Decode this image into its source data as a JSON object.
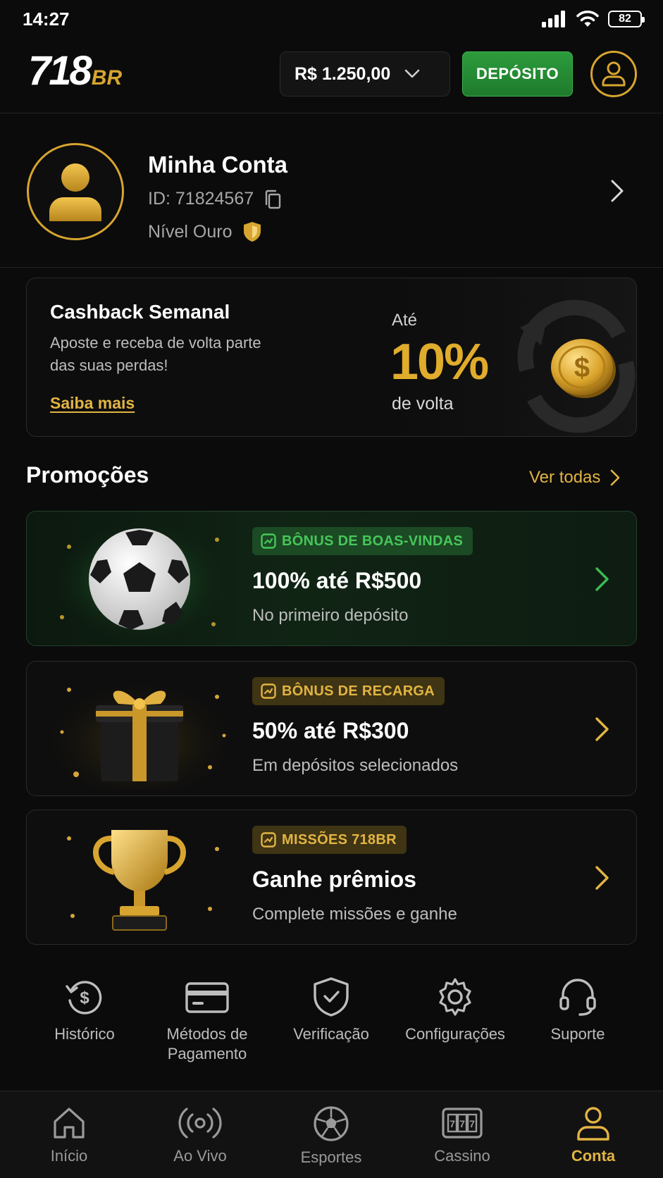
{
  "status_bar": {
    "time": "14:27",
    "battery": "82"
  },
  "header": {
    "logo_main": "718",
    "logo_suffix": "BR",
    "balance": "R$ 1.250,00",
    "deposit_label": "DEPÓSITO"
  },
  "account": {
    "title": "Minha Conta",
    "id_text": "ID: 71824567",
    "level_text": "Nível Ouro"
  },
  "cashback": {
    "title": "Cashback Semanal",
    "description": "Aposte e receba de volta parte das suas perdas!",
    "link": "Saiba mais",
    "prefix": "Até",
    "percent": "10%",
    "suffix": "de volta"
  },
  "promotions": {
    "heading": "Promoções",
    "see_all": "Ver todas",
    "items": [
      {
        "badge": "BÔNUS DE BOAS-VINDAS",
        "title": "100% até R$500",
        "subtitle": "No primeiro depósito",
        "theme": "green",
        "art": "soccer-ball"
      },
      {
        "badge": "BÔNUS DE RECARGA",
        "title": "50% até R$300",
        "subtitle": "Em depósitos selecionados",
        "theme": "gold",
        "art": "gift-box"
      },
      {
        "badge": "MISSÕES 718BR",
        "title": "Ganhe prêmios",
        "subtitle": "Complete missões e ganhe",
        "theme": "gold",
        "art": "trophy"
      }
    ]
  },
  "quick_actions": [
    {
      "label": "Histórico",
      "icon": "history-icon"
    },
    {
      "label": "Métodos de Pagamento",
      "icon": "card-icon"
    },
    {
      "label": "Verificação",
      "icon": "shield-check-icon"
    },
    {
      "label": "Configurações",
      "icon": "gear-icon"
    },
    {
      "label": "Suporte",
      "icon": "headset-icon"
    }
  ],
  "bottom_nav": [
    {
      "label": "Início",
      "icon": "home-icon"
    },
    {
      "label": "Ao Vivo",
      "icon": "live-icon"
    },
    {
      "label": "Esportes",
      "icon": "soccer-icon"
    },
    {
      "label": "Cassino",
      "icon": "slot-machine-icon"
    },
    {
      "label": "Conta",
      "icon": "user-icon",
      "active": true
    }
  ],
  "colors": {
    "gold": "#e2b443",
    "green": "#2c9c3c",
    "background": "#0b0b0b"
  }
}
